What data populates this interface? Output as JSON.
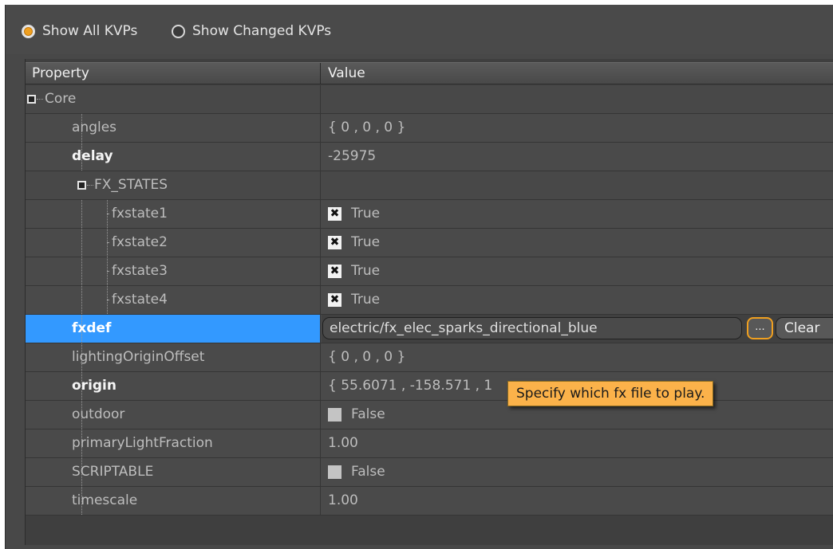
{
  "filter": {
    "show_all_label": "Show All KVPs",
    "show_changed_label": "Show Changed KVPs",
    "selected": "show_all"
  },
  "header": {
    "property": "Property",
    "value": "Value"
  },
  "rows": [
    {
      "kind": "category",
      "level": 0,
      "name": "Core"
    },
    {
      "kind": "prop",
      "level": 1,
      "name": "angles",
      "value": "{ 0 , 0 , 0 }"
    },
    {
      "kind": "prop",
      "level": 1,
      "name": "delay",
      "value": "-25975",
      "bold": true
    },
    {
      "kind": "category",
      "level": 1,
      "name": "FX_STATES"
    },
    {
      "kind": "prop",
      "level": 2,
      "name": "fxstate1",
      "value": "True",
      "checkbox": "checked"
    },
    {
      "kind": "prop",
      "level": 2,
      "name": "fxstate2",
      "value": "True",
      "checkbox": "checked"
    },
    {
      "kind": "prop",
      "level": 2,
      "name": "fxstate3",
      "value": "True",
      "checkbox": "checked"
    },
    {
      "kind": "prop",
      "level": 2,
      "name": "fxstate4",
      "value": "True",
      "checkbox": "checked"
    },
    {
      "kind": "prop",
      "level": 1,
      "name": "fxdef",
      "value": "electric/fx_elec_sparks_directional_blue",
      "bold": true,
      "selected": true,
      "editor": "file"
    },
    {
      "kind": "prop",
      "level": 1,
      "name": "lightingOriginOffset",
      "value": "{ 0 , 0 , 0 }"
    },
    {
      "kind": "prop",
      "level": 1,
      "name": "origin",
      "value": "{ 55.6071 , -158.571 , 1",
      "bold": true
    },
    {
      "kind": "prop",
      "level": 1,
      "name": "outdoor",
      "value": "False",
      "checkbox": "unchecked"
    },
    {
      "kind": "prop",
      "level": 1,
      "name": "primaryLightFraction",
      "value": "1.00"
    },
    {
      "kind": "prop",
      "level": 1,
      "name": "SCRIPTABLE",
      "value": "False",
      "checkbox": "unchecked"
    },
    {
      "kind": "prop",
      "level": 1,
      "name": "timescale",
      "value": "1.00"
    }
  ],
  "fx_editor": {
    "browse_label": "...",
    "clear_label": "Clear"
  },
  "tooltip": {
    "text": "Specify which fx file to play."
  },
  "colors": {
    "panel_bg": "#484848",
    "selection": "#3399ff",
    "accent": "#f0a020",
    "tooltip_bg": "#fbb24a"
  }
}
